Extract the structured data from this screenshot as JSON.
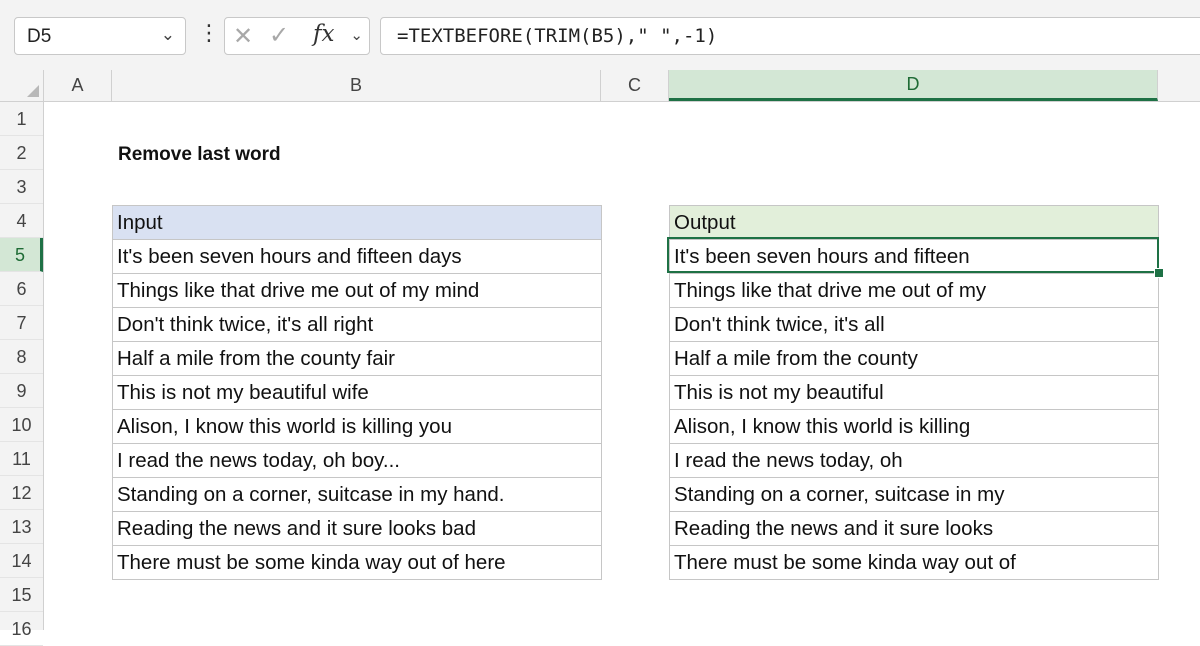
{
  "formula_bar": {
    "name_box": "D5",
    "name_box_icon": "chevron-down-icon",
    "formula": "=TEXTBEFORE(TRIM(B5),\" \",-1)",
    "fx_label": "fx"
  },
  "columns": [
    "A",
    "B",
    "C",
    "D"
  ],
  "active_column": "D",
  "rows": [
    "1",
    "2",
    "3",
    "4",
    "5",
    "6",
    "7",
    "8",
    "9",
    "10",
    "11",
    "12",
    "13",
    "14",
    "15",
    "16"
  ],
  "active_row": "5",
  "sheet": {
    "title": "Remove last word",
    "input_header": "Input",
    "output_header": "Output",
    "inputs": [
      "It's been seven hours and fifteen days",
      "Things like that drive me out of my mind",
      "Don't think twice, it's all right",
      "Half a mile from the county fair",
      "This is not my beautiful wife",
      "Alison, I know this world is killing you",
      "I read the news today, oh boy...",
      "Standing on a corner, suitcase in my hand.",
      "Reading the news and it sure looks bad",
      "There must be some kinda way out of here"
    ],
    "outputs": [
      "It's been seven hours and fifteen",
      "Things like that drive me out of my",
      "Don't think twice, it's all",
      "Half a mile from the county",
      "This is not my beautiful",
      "Alison, I know this world is killing",
      "I read the news today, oh",
      "Standing on a corner, suitcase in my",
      "Reading the news and it sure looks",
      "There must be some kinda way out of"
    ]
  },
  "colors": {
    "accent": "#1e7145",
    "input_header_bg": "#d9e1f2",
    "output_header_bg": "#e2efda"
  }
}
